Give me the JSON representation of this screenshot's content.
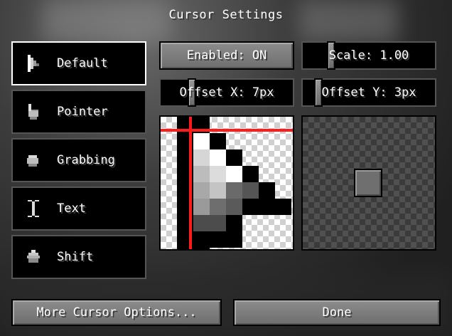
{
  "screen": {
    "title": "Cursor Settings"
  },
  "cursor_types": [
    {
      "label": "Default",
      "icon": "arrow-cursor-icon"
    },
    {
      "label": "Pointer",
      "icon": "pointer-hand-icon"
    },
    {
      "label": "Grabbing",
      "icon": "grabbing-hand-icon"
    },
    {
      "label": "Text",
      "icon": "text-ibeam-icon"
    },
    {
      "label": "Shift",
      "icon": "shift-arrow-icon"
    }
  ],
  "selected_cursor": "Default",
  "controls": {
    "enabled_label": "Enabled: ON",
    "scale_label": "Scale: 1.00",
    "scale_value": 1.0,
    "offset_x_label": "Offset X: 7px",
    "offset_x_value": 7,
    "offset_y_label": "Offset Y: 3px",
    "offset_y_value": 3
  },
  "buttons": {
    "more_options": "More Cursor Options...",
    "done": "Done"
  },
  "colors": {
    "selected_border": "#ffffff",
    "hotspot_crosshair": "#ff1b1b",
    "button_face": "#7e7e7e"
  }
}
